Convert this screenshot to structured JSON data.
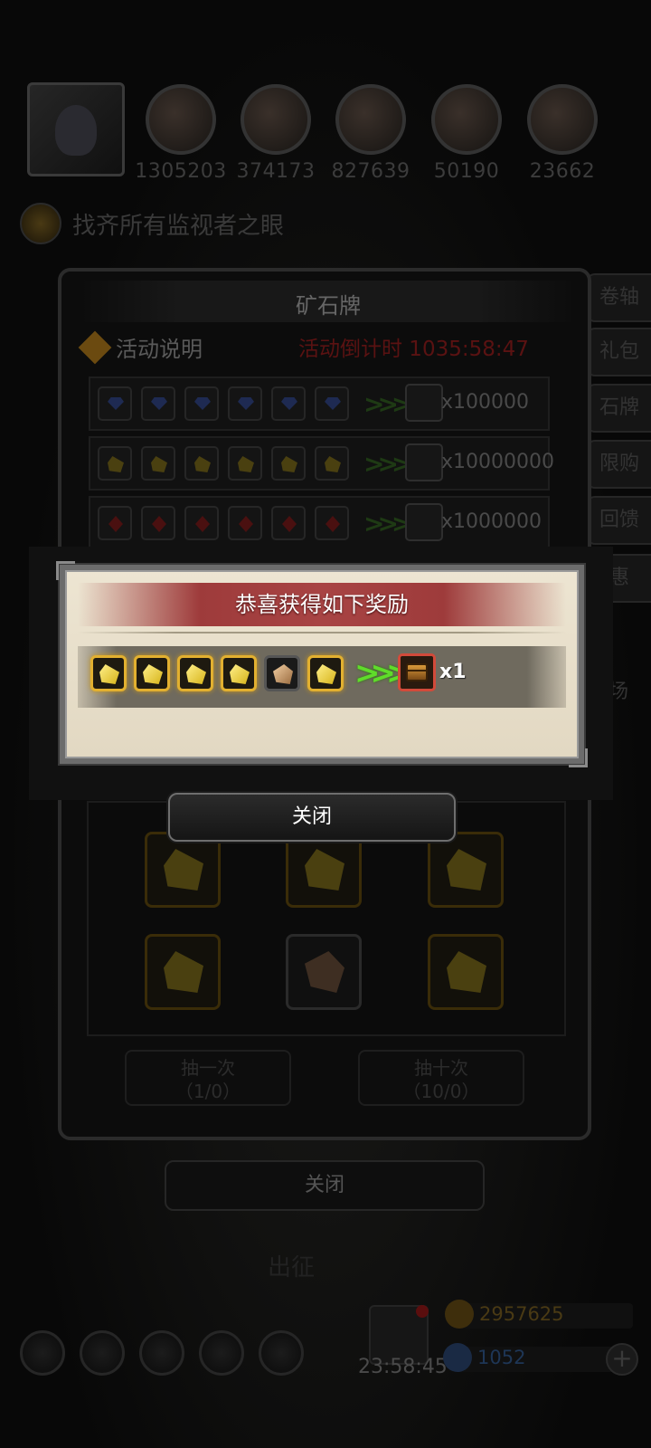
{
  "resources": [
    {
      "icon": "meat-icon",
      "value": "1305203"
    },
    {
      "icon": "wood-icon",
      "value": "374173"
    },
    {
      "icon": "stone-icon",
      "value": "827639"
    },
    {
      "icon": "crystal-icon",
      "value": "50190"
    },
    {
      "icon": "iron-icon",
      "value": "23662"
    }
  ],
  "quest": {
    "text": "找齐所有监视者之眼"
  },
  "side_tabs": [
    "卷轴",
    "礼包",
    "石牌",
    "限购",
    "回馈",
    "惠",
    "场"
  ],
  "panel": {
    "title": "矿石牌",
    "info_label": "活动说明",
    "countdown": "活动倒计时 1035:58:47",
    "recipes": [
      {
        "gem": "blue",
        "qty": "x100000"
      },
      {
        "gem": "gold",
        "qty": "x10000000"
      },
      {
        "gem": "red",
        "qty": "x1000000"
      }
    ],
    "draw_once": {
      "label": "抽一次",
      "count": "（1/0）"
    },
    "draw_ten": {
      "label": "抽十次",
      "count": "（10/0）"
    },
    "close_label": "关闭",
    "dispatch_label": "出征"
  },
  "bottom": {
    "gift_timer": "23:58:45",
    "gold": "2957625",
    "diamond": "1052",
    "plus": "+"
  },
  "popup": {
    "title": "恭喜获得如下奖励",
    "reward_qty": "x1",
    "close_label": "关闭"
  },
  "colors": {
    "accent_gold": "#e2b030",
    "arrow_green": "#5fdc2a",
    "banner_red": "#a84444",
    "countdown_red": "#5a1212"
  }
}
